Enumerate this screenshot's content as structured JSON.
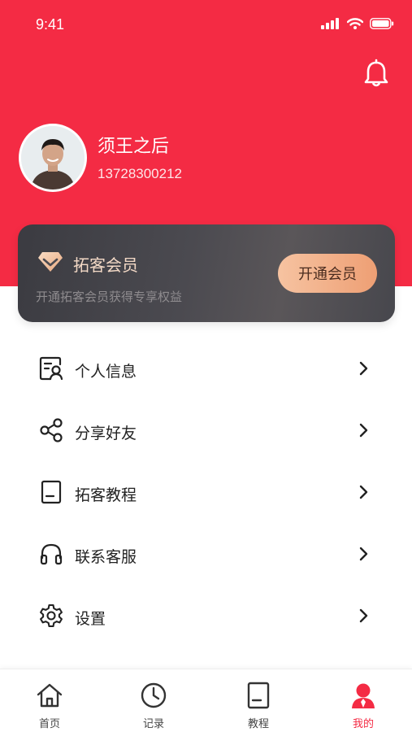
{
  "status_bar": {
    "time": "9:41"
  },
  "profile": {
    "name": "须王之后",
    "phone": "13728300212"
  },
  "vip": {
    "title": "拓客会员",
    "subtitle": "开通拓客会员获得专享权益",
    "button_label": "开通会员",
    "icon": "diamond-icon"
  },
  "menu": {
    "items": [
      {
        "label": "个人信息",
        "icon": "profile-card-icon"
      },
      {
        "label": "分享好友",
        "icon": "share-icon"
      },
      {
        "label": "拓客教程",
        "icon": "document-icon"
      },
      {
        "label": "联系客服",
        "icon": "headset-icon"
      },
      {
        "label": "设置",
        "icon": "gear-icon"
      }
    ]
  },
  "tabbar": {
    "active": "我的",
    "items": [
      {
        "label": "首页",
        "icon": "home-icon"
      },
      {
        "label": "记录",
        "icon": "clock-icon"
      },
      {
        "label": "教程",
        "icon": "document-icon"
      },
      {
        "label": "我的",
        "icon": "person-icon"
      }
    ]
  },
  "colors": {
    "brand_red": "#f42b44",
    "vip_gold": "#f3d9c6",
    "button_gradient_start": "#f6c3a1",
    "button_gradient_end": "#ee9f74"
  }
}
